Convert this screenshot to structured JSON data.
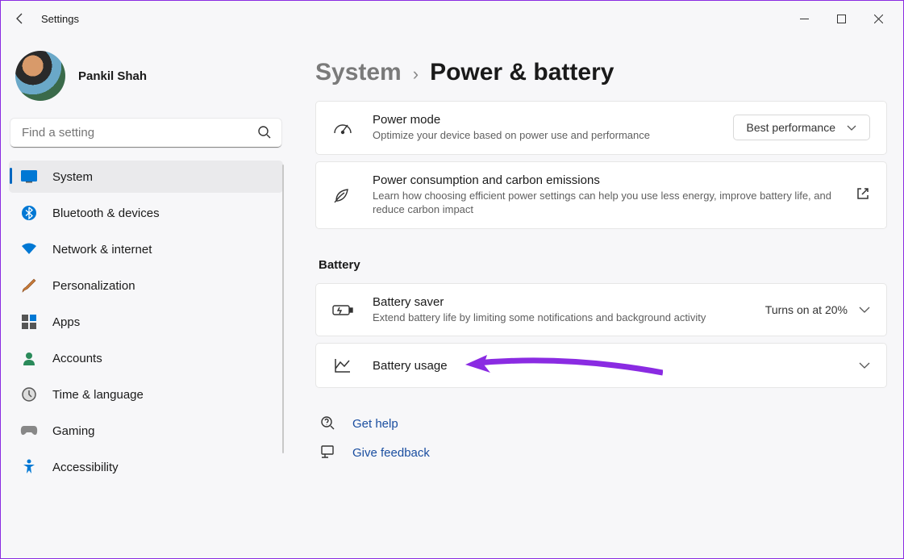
{
  "window": {
    "title": "Settings"
  },
  "profile": {
    "name": "Pankil Shah"
  },
  "search": {
    "placeholder": "Find a setting"
  },
  "sidebar": {
    "items": [
      {
        "label": "System"
      },
      {
        "label": "Bluetooth & devices"
      },
      {
        "label": "Network & internet"
      },
      {
        "label": "Personalization"
      },
      {
        "label": "Apps"
      },
      {
        "label": "Accounts"
      },
      {
        "label": "Time & language"
      },
      {
        "label": "Gaming"
      },
      {
        "label": "Accessibility"
      }
    ]
  },
  "breadcrumb": {
    "root": "System",
    "page": "Power & battery"
  },
  "cards": {
    "power_mode": {
      "title": "Power mode",
      "sub": "Optimize your device based on power use and performance",
      "value": "Best performance"
    },
    "carbon": {
      "title": "Power consumption and carbon emissions",
      "sub": "Learn how choosing efficient power settings can help you use less energy, improve battery life, and reduce carbon impact"
    },
    "battery_saver": {
      "title": "Battery saver",
      "sub": "Extend battery life by limiting some notifications and background activity",
      "status": "Turns on at 20%"
    },
    "battery_usage": {
      "title": "Battery usage"
    }
  },
  "section": {
    "battery": "Battery"
  },
  "help": {
    "get_help": "Get help",
    "feedback": "Give feedback"
  }
}
